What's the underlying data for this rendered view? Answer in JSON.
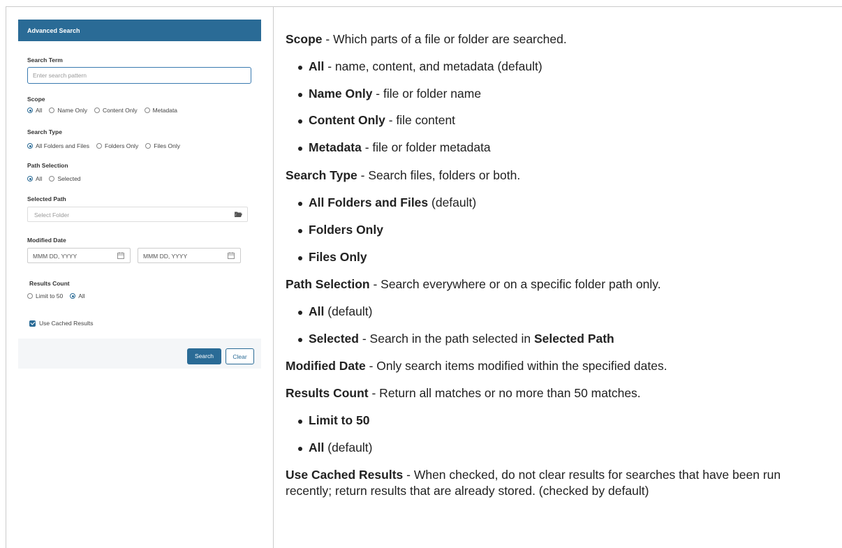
{
  "panel": {
    "title": "Advanced Search",
    "search_term": {
      "label": "Search Term",
      "placeholder": "Enter search pattern"
    },
    "scope": {
      "label": "Scope",
      "options": [
        "All",
        "Name Only",
        "Content Only",
        "Metadata"
      ],
      "selected": "All"
    },
    "search_type": {
      "label": "Search Type",
      "options": [
        "All Folders and Files",
        "Folders Only",
        "Files Only"
      ],
      "selected": "All Folders and Files"
    },
    "path_selection": {
      "label": "Path Selection",
      "options": [
        "All",
        "Selected"
      ],
      "selected": "All"
    },
    "selected_path": {
      "label": "Selected Path",
      "placeholder": "Select Folder",
      "icon": "folder-open-icon"
    },
    "modified_date": {
      "label": "Modified Date",
      "from_placeholder": "MMM DD, YYYY",
      "to_placeholder": "MMM DD, YYYY",
      "icon": "calendar-icon"
    },
    "results_count": {
      "label": "Results Count",
      "options": [
        "Limit to 50",
        "All"
      ],
      "selected": "All"
    },
    "use_cached": {
      "label": "Use Cached Results",
      "checked": true
    },
    "buttons": {
      "search": "Search",
      "clear": "Clear"
    },
    "colors": {
      "accent": "#2a6b96"
    }
  },
  "doc": {
    "scope": {
      "term": "Scope",
      "desc": " - Which parts of a file or folder are searched."
    },
    "scope_items": [
      {
        "term": "All",
        "desc": " - name, content, and metadata (default)"
      },
      {
        "term": "Name Only",
        "desc": " - file or folder name"
      },
      {
        "term": "Content Only",
        "desc": " - file content"
      },
      {
        "term": "Metadata",
        "desc": " - file or folder metadata"
      }
    ],
    "search_type": {
      "term": "Search Type",
      "desc": " - Search files, folders or both."
    },
    "search_type_items": [
      {
        "term": "All Folders and Files",
        "desc": " (default)"
      },
      {
        "term": "Folders Only",
        "desc": ""
      },
      {
        "term": "Files Only",
        "desc": ""
      }
    ],
    "path_selection": {
      "term": "Path Selection",
      "desc": " - Search everywhere or on a specific folder path only."
    },
    "path_items": [
      {
        "term": "All",
        "desc": " (default)"
      },
      {
        "term": "Selected",
        "desc": " - Search in the path selected in ",
        "term2": "Selected Path"
      }
    ],
    "modified_date": {
      "term": "Modified Date",
      "desc": " - Only search items modified within the specified dates."
    },
    "results_count": {
      "term": "Results Count",
      "desc": " - Return all matches or no more than 50 matches."
    },
    "results_items": [
      {
        "term": "Limit to 50",
        "desc": ""
      },
      {
        "term": "All",
        "desc": " (default)"
      }
    ],
    "use_cached": {
      "term": "Use Cached Results",
      "desc": " - When checked, do not clear results for searches that have been run recently; return results that are already stored. (checked by default)"
    }
  }
}
